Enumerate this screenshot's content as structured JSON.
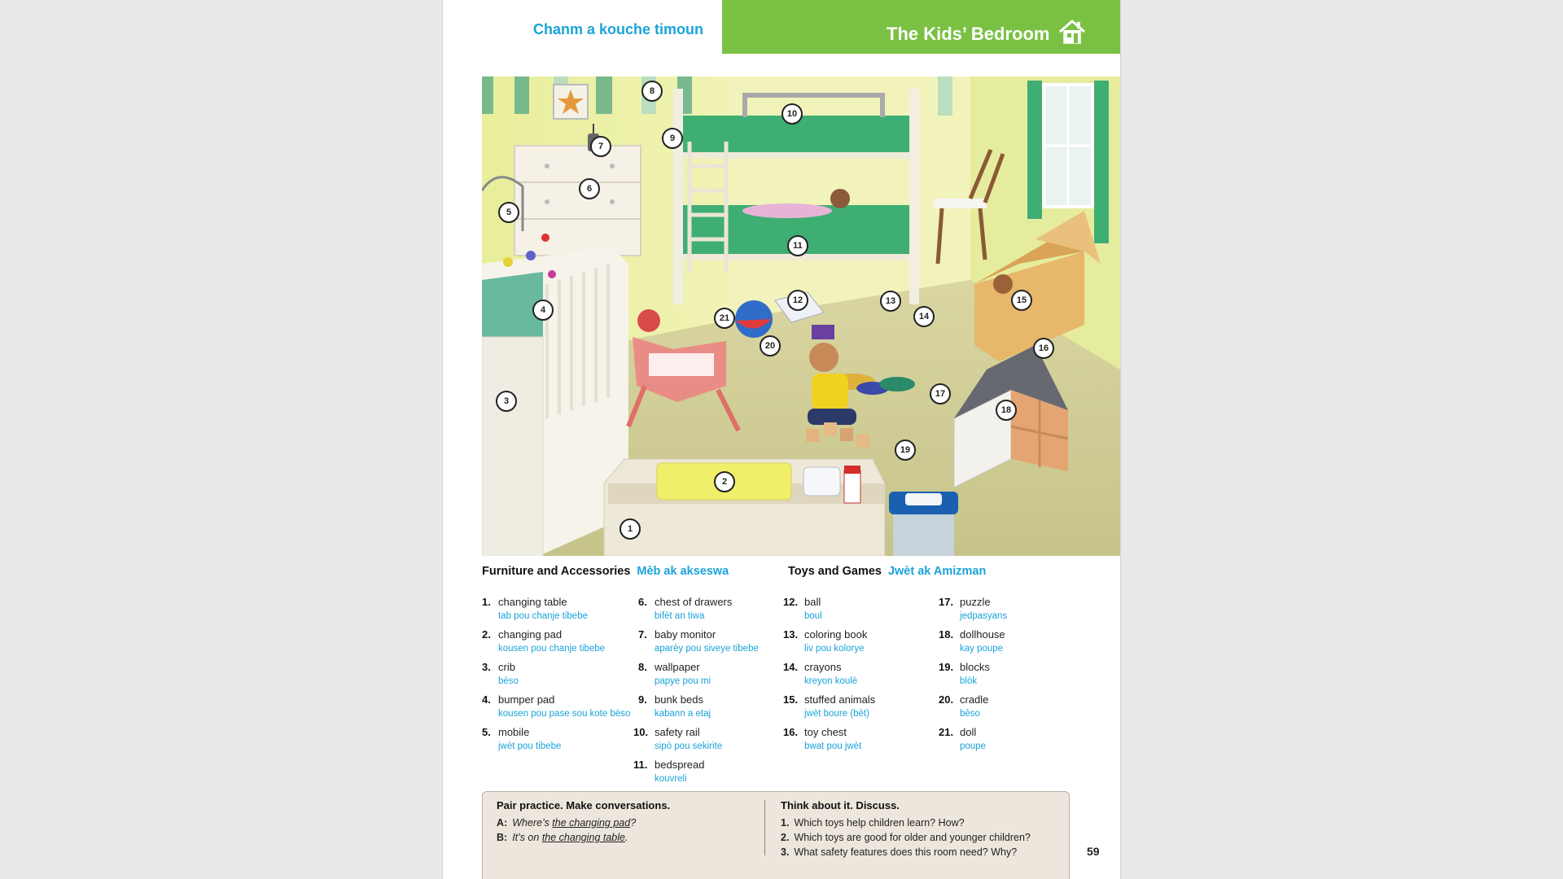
{
  "header": {
    "left_title": "Chanm a kouche timoun",
    "right_title": "The Kids’ Bedroom",
    "icon": "house-icon",
    "colors": {
      "accent_green": "#7ac143",
      "accent_blue": "#1aa3d8"
    }
  },
  "scene_callouts": [
    "1",
    "2",
    "3",
    "4",
    "5",
    "6",
    "7",
    "8",
    "9",
    "10",
    "11",
    "12",
    "13",
    "14",
    "15",
    "16",
    "17",
    "18",
    "19",
    "20",
    "21"
  ],
  "sections": {
    "furniture": {
      "title": "Furniture and Accessories",
      "title_kreyol": "Mèb ak akseswa"
    },
    "toys": {
      "title": "Toys and Games",
      "title_kreyol": "Jwèt ak Amizman"
    }
  },
  "columns": [
    [
      {
        "num": "1.",
        "en": "changing table",
        "kr": "tab pou chanje tibebe"
      },
      {
        "num": "2.",
        "en": "changing pad",
        "kr": "kousen pou chanje tibebe"
      },
      {
        "num": "3.",
        "en": "crib",
        "kr": "bèso"
      },
      {
        "num": "4.",
        "en": "bumper pad",
        "kr": "kousen pou pase sou kote bèso"
      },
      {
        "num": "5.",
        "en": "mobile",
        "kr": "jwèt pou tibebe"
      }
    ],
    [
      {
        "num": "6.",
        "en": "chest of drawers",
        "kr": "bifèt an tiwa"
      },
      {
        "num": "7.",
        "en": "baby monitor",
        "kr": "aparèy pou siveye tibebe"
      },
      {
        "num": "8.",
        "en": "wallpaper",
        "kr": "papye pou mi"
      },
      {
        "num": "9.",
        "en": "bunk beds",
        "kr": "kabann a etaj"
      },
      {
        "num": "10.",
        "en": "safety rail",
        "kr": "sipò pou sekirite"
      },
      {
        "num": "11.",
        "en": "bedspread",
        "kr": "kouvreli"
      }
    ],
    [
      {
        "num": "12.",
        "en": "ball",
        "kr": "boul"
      },
      {
        "num": "13.",
        "en": "coloring book",
        "kr": "liv pou kolorye"
      },
      {
        "num": "14.",
        "en": "crayons",
        "kr": "kreyon koulè"
      },
      {
        "num": "15.",
        "en": "stuffed animals",
        "kr": "jwèt boure (bèt)"
      },
      {
        "num": "16.",
        "en": "toy chest",
        "kr": "bwat pou jwèt"
      }
    ],
    [
      {
        "num": "17.",
        "en": "puzzle",
        "kr": "jedpasyans"
      },
      {
        "num": "18.",
        "en": "dollhouse",
        "kr": "kay poupe"
      },
      {
        "num": "19.",
        "en": "blocks",
        "kr": "blòk"
      },
      {
        "num": "20.",
        "en": "cradle",
        "kr": "bèso"
      },
      {
        "num": "21.",
        "en": "doll",
        "kr": "poupe"
      }
    ]
  ],
  "practice": {
    "left_title": "Pair practice. Make conversations.",
    "a_label": "A:",
    "a_pre": "Where’s ",
    "a_ul": "the changing pad",
    "a_post": "?",
    "b_label": "B:",
    "b_pre": "It’s on ",
    "b_ul": "the changing table",
    "b_post": ".",
    "right_title": "Think about it. Discuss.",
    "questions": [
      {
        "num": "1.",
        "text": "Which toys help children learn? How?"
      },
      {
        "num": "2.",
        "text": "Which toys are good for older and younger children?"
      },
      {
        "num": "3.",
        "text": "What safety features does this room need? Why?"
      }
    ]
  },
  "page_number": "59"
}
